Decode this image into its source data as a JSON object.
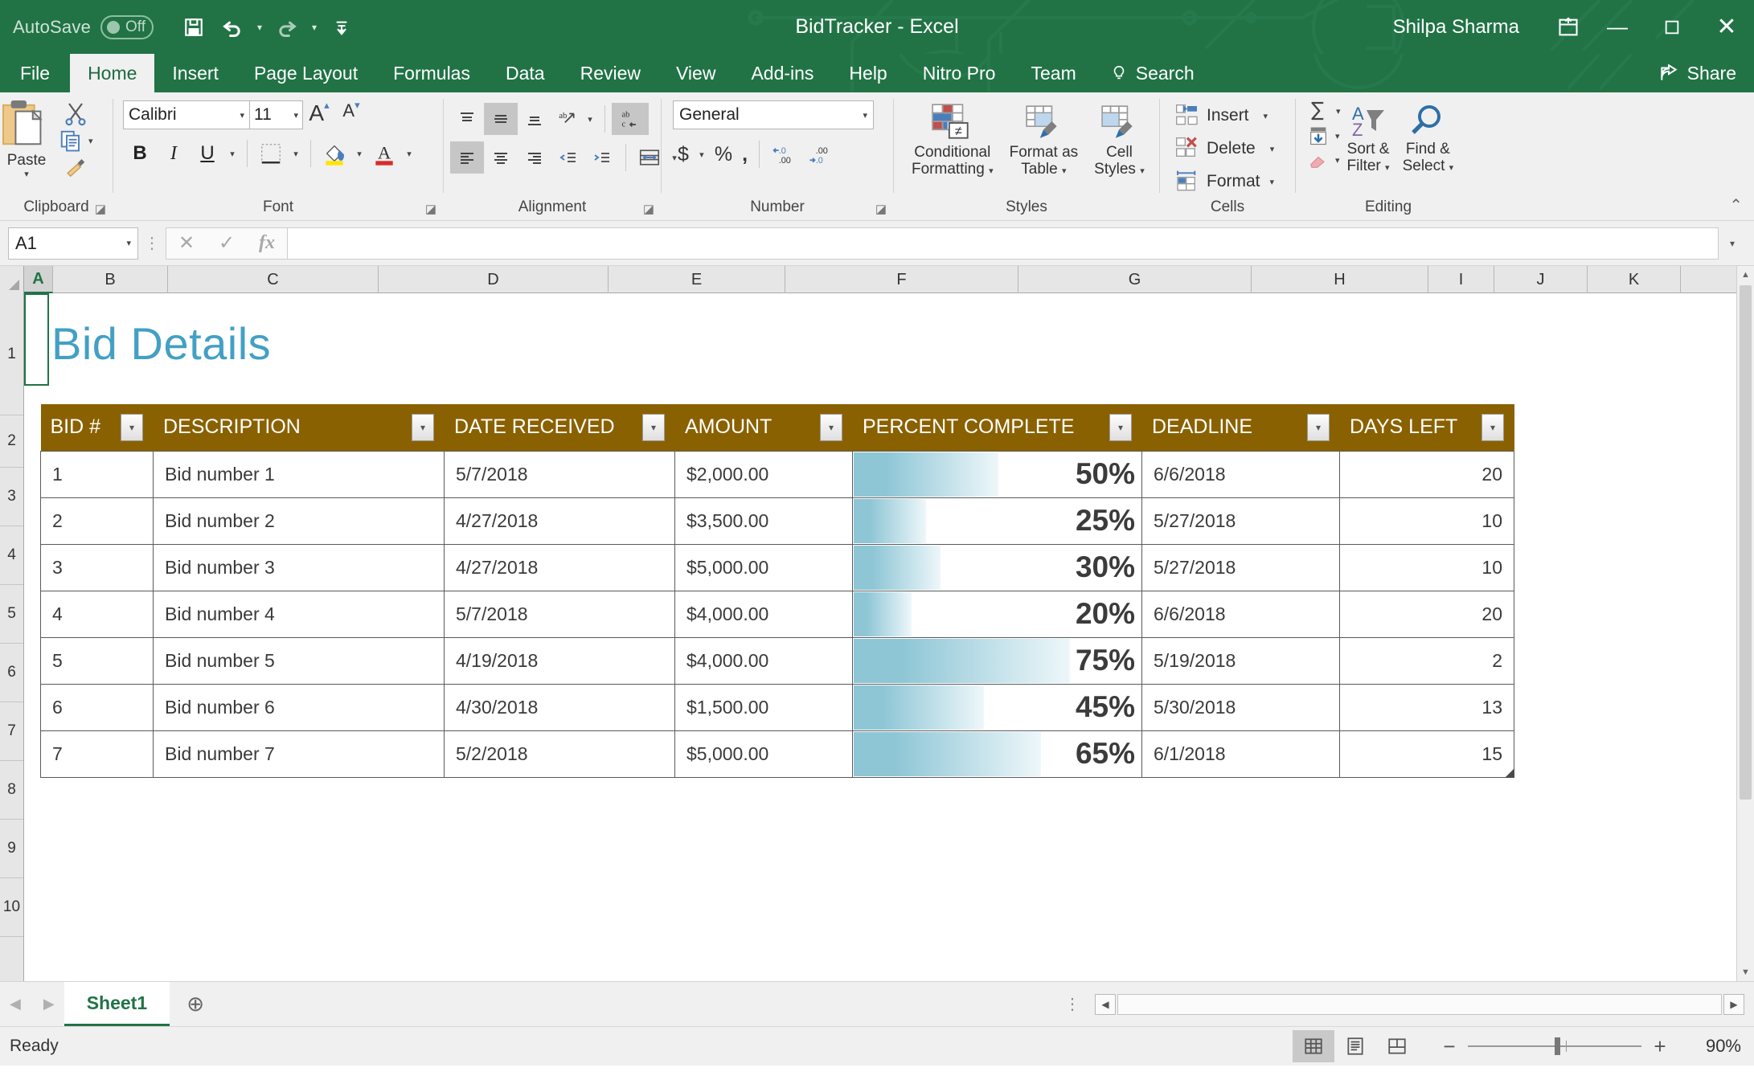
{
  "titlebar": {
    "autosave_label": "AutoSave",
    "autosave_state": "Off",
    "save_icon": "save-icon",
    "undo_icon": "undo-icon",
    "redo_icon": "redo-icon",
    "customize_icon": "customize-quick-access-icon",
    "document_title": "BidTracker  -  Excel",
    "username": "Shilpa Sharma",
    "ribbon_display_icon": "ribbon-display-options-icon",
    "minimize": "—",
    "maximize": "☐",
    "close": "✕",
    "accent_color": "#217346"
  },
  "ribbon_tabs": {
    "items": [
      {
        "label": "File",
        "active": false
      },
      {
        "label": "Home",
        "active": true
      },
      {
        "label": "Insert",
        "active": false
      },
      {
        "label": "Page Layout",
        "active": false
      },
      {
        "label": "Formulas",
        "active": false
      },
      {
        "label": "Data",
        "active": false
      },
      {
        "label": "Review",
        "active": false
      },
      {
        "label": "View",
        "active": false
      },
      {
        "label": "Add-ins",
        "active": false
      },
      {
        "label": "Help",
        "active": false
      },
      {
        "label": "Nitro Pro",
        "active": false
      },
      {
        "label": "Team",
        "active": false
      }
    ],
    "search_label": "Search",
    "share_label": "Share"
  },
  "ribbon": {
    "clipboard": {
      "name": "Clipboard",
      "paste_label": "Paste",
      "cut_icon": "scissors-icon",
      "copy_icon": "copy-icon",
      "format_painter_icon": "format-painter-icon"
    },
    "font": {
      "name": "Font",
      "font_family_value": "Calibri",
      "font_size_value": "11",
      "grow_font": "A",
      "shrink_font": "A",
      "bold": "B",
      "italic": "I",
      "underline": "U",
      "borders_icon": "borders-icon",
      "fill_color_icon": "fill-color-icon",
      "font_color_icon": "font-color-icon"
    },
    "alignment": {
      "name": "Alignment",
      "top_align_icon": "align-top-icon",
      "middle_align_icon": "align-middle-icon",
      "bottom_align_icon": "align-bottom-icon",
      "orientation_icon": "orientation-icon",
      "align_left_icon": "align-left-icon",
      "align_center_icon": "align-center-icon",
      "align_right_icon": "align-right-icon",
      "decrease_indent_icon": "decrease-indent-icon",
      "increase_indent_icon": "increase-indent-icon",
      "wrap_text_icon": "wrap-text-icon",
      "merge_center_icon": "merge-and-center-icon"
    },
    "number": {
      "name": "Number",
      "format_value": "General",
      "currency": "$",
      "percent": "%",
      "comma": ",",
      "increase_decimal_icon": "increase-decimal-icon",
      "decrease_decimal_icon": "decrease-decimal-icon"
    },
    "styles": {
      "name": "Styles",
      "conditional_formatting": "Conditional\nFormatting",
      "conditional_formatting_l1": "Conditional",
      "conditional_formatting_l2": "Formatting",
      "format_as_table_l1": "Format as",
      "format_as_table_l2": "Table",
      "cell_styles_l1": "Cell",
      "cell_styles_l2": "Styles"
    },
    "cells": {
      "name": "Cells",
      "insert_label": "Insert",
      "delete_label": "Delete",
      "format_label": "Format"
    },
    "editing": {
      "name": "Editing",
      "autosum_icon": "autosum-sigma-icon",
      "fill_icon": "fill-down-icon",
      "clear_icon": "clear-eraser-icon",
      "sort_filter_l1": "Sort &",
      "sort_filter_l2": "Filter",
      "find_select_l1": "Find &",
      "find_select_l2": "Select"
    },
    "collapse_icon": "collapse-ribbon-icon"
  },
  "formula_bar": {
    "name_box_value": "A1",
    "cancel_icon": "cancel-x-icon",
    "enter_icon": "enter-check-icon",
    "insert_function_icon": "fx-icon",
    "formula_value": ""
  },
  "grid": {
    "columns": [
      "A",
      "B",
      "C",
      "D",
      "E",
      "F",
      "G",
      "H",
      "I",
      "J",
      "K"
    ],
    "selected_column": "A",
    "rows": [
      "1",
      "2",
      "3",
      "4",
      "5",
      "6",
      "7",
      "8",
      "9",
      "10"
    ],
    "selected_cell": "A1",
    "sheet_title": "Bid Details",
    "sheet_title_color": "#43a0c4"
  },
  "table": {
    "header_bg": "#8a6100",
    "bar_color": "#8ec6d6",
    "headers": [
      "BID #",
      "DESCRIPTION",
      "DATE RECEIVED",
      "AMOUNT",
      "PERCENT COMPLETE",
      "DEADLINE",
      "DAYS LEFT"
    ],
    "rows": [
      {
        "bid": "1",
        "description": "Bid number 1",
        "date_received": "5/7/2018",
        "amount": "$2,000.00",
        "percent_label": "50%",
        "percent": 50,
        "deadline": "6/6/2018",
        "days_left": "20"
      },
      {
        "bid": "2",
        "description": "Bid number 2",
        "date_received": "4/27/2018",
        "amount": "$3,500.00",
        "percent_label": "25%",
        "percent": 25,
        "deadline": "5/27/2018",
        "days_left": "10"
      },
      {
        "bid": "3",
        "description": "Bid number 3",
        "date_received": "4/27/2018",
        "amount": "$5,000.00",
        "percent_label": "30%",
        "percent": 30,
        "deadline": "5/27/2018",
        "days_left": "10"
      },
      {
        "bid": "4",
        "description": "Bid number 4",
        "date_received": "5/7/2018",
        "amount": "$4,000.00",
        "percent_label": "20%",
        "percent": 20,
        "deadline": "6/6/2018",
        "days_left": "20"
      },
      {
        "bid": "5",
        "description": "Bid number 5",
        "date_received": "4/19/2018",
        "amount": "$4,000.00",
        "percent_label": "75%",
        "percent": 75,
        "deadline": "5/19/2018",
        "days_left": "2"
      },
      {
        "bid": "6",
        "description": "Bid number 6",
        "date_received": "4/30/2018",
        "amount": "$1,500.00",
        "percent_label": "45%",
        "percent": 45,
        "deadline": "5/30/2018",
        "days_left": "13"
      },
      {
        "bid": "7",
        "description": "Bid number 7",
        "date_received": "5/2/2018",
        "amount": "$5,000.00",
        "percent_label": "65%",
        "percent": 65,
        "deadline": "6/1/2018",
        "days_left": "15"
      }
    ]
  },
  "sheet_tabs": {
    "prev_icon": "previous-sheet-icon",
    "next_icon": "next-sheet-icon",
    "tabs": [
      {
        "label": "Sheet1",
        "active": true
      }
    ],
    "add_sheet_icon": "add-sheet-plus-icon"
  },
  "status_bar": {
    "status_text": "Ready",
    "normal_view_icon": "normal-view-icon",
    "page_layout_icon": "page-layout-view-icon",
    "page_break_icon": "page-break-preview-icon",
    "zoom_out": "−",
    "zoom_in": "+",
    "zoom_level": "90%"
  }
}
